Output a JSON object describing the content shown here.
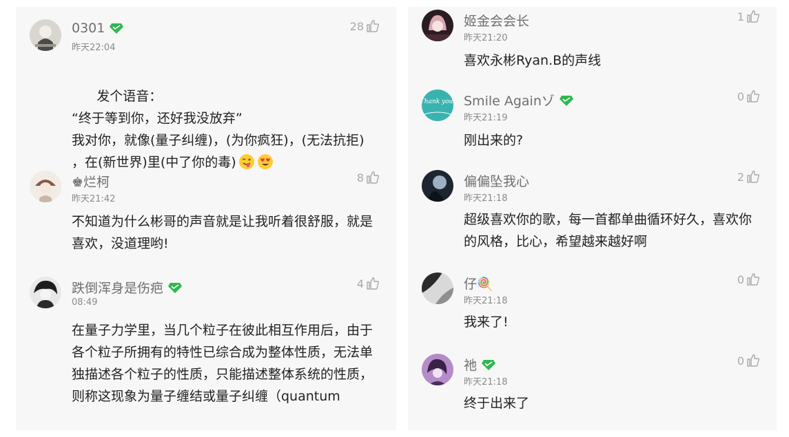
{
  "left_column": {
    "comments": [
      {
        "username": "0301",
        "has_vip_badge": true,
        "timestamp": "昨天22:04",
        "likes": "28",
        "text": "发个语音：\n“终于等到你，还好我没放弃”\n我对你，就像(量子纠缠)，(为你疯狂)，(无法抗拒)\n，在(新世界)里(中了你的毒)",
        "emojis": [
          "winking-tongue-emoji",
          "heart-eyes-emoji"
        ]
      },
      {
        "username": "♚烂柯",
        "has_vip_badge": false,
        "timestamp": "昨天21:42",
        "likes": "8",
        "text": "不知道为什么彬哥的声音就是让我听着很舒服，就是喜欢，没道理哟!"
      },
      {
        "username": "跌倒浑身是伤疤",
        "has_vip_badge": true,
        "timestamp": "08:49",
        "likes": "4",
        "text": "在量子力学里，当几个粒子在彼此相互作用后，由于各个粒子所拥有的特性已综合成为整体性质，无法单独描述各个粒子的性质，只能描述整体系统的性质，则称这现象为量子缠结或量子纠缠（quantum"
      }
    ]
  },
  "right_column": {
    "comments": [
      {
        "username": "姬金会会长",
        "has_vip_badge": false,
        "timestamp": "昨天21:20",
        "likes": "1",
        "text": "喜欢永彬Ryan.B的声线"
      },
      {
        "username": "Smile Againゾ",
        "has_vip_badge": true,
        "timestamp": "昨天21:19",
        "likes": "0",
        "text": "刚出来的?"
      },
      {
        "username": "偏偏坠我心",
        "has_vip_badge": false,
        "timestamp": "昨天21:18",
        "likes": "2",
        "text": "超级喜欢你的歌，每一首都单曲循环好久，喜欢你的风格，比心，希望越来越好啊"
      },
      {
        "username": "仔🍭",
        "has_vip_badge": false,
        "timestamp": "昨天21:18",
        "likes": "0",
        "text": "我来了!"
      },
      {
        "username": "祂",
        "has_vip_badge": true,
        "timestamp": "昨天21:18",
        "likes": "0",
        "text": "终于出来了"
      }
    ]
  },
  "avatar_texts": {
    "thank_you": "Thank you."
  },
  "colors": {
    "panel_bg": "#f7f7f7",
    "username": "#6f6f6f",
    "timestamp": "#8a8a8a",
    "likes": "#a8a8a8",
    "body": "#222222",
    "vip_green": "#2fb84f"
  }
}
